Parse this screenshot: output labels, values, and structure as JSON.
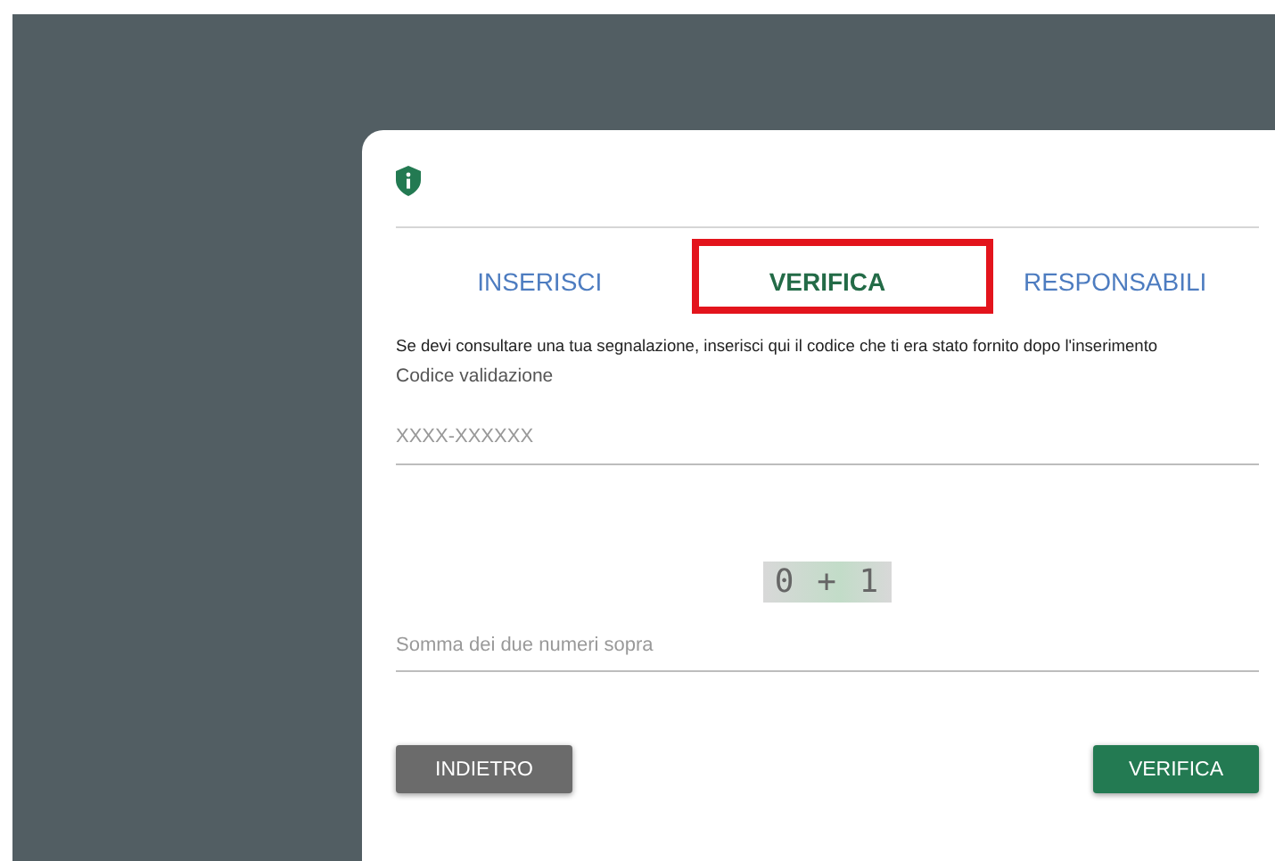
{
  "tabs": [
    {
      "label": "INSERISCI",
      "selected": false,
      "highlighted": false
    },
    {
      "label": "VERIFICA",
      "selected": true,
      "highlighted": true
    },
    {
      "label": "RESPONSABILI",
      "selected": false,
      "highlighted": false
    }
  ],
  "instructions": "Se devi consultare una tua segnalazione, inserisci qui il codice che ti era stato fornito dopo l'inserimento",
  "code_field": {
    "label": "Codice validazione",
    "placeholder": "XXXX-XXXXXX"
  },
  "captcha": "0 + 1",
  "sum_field": {
    "placeholder": "Somma dei due numeri sopra"
  },
  "buttons": [
    {
      "label": "INDIETRO",
      "kind": "secondary"
    },
    {
      "label": "VERIFICA",
      "kind": "primary"
    }
  ]
}
